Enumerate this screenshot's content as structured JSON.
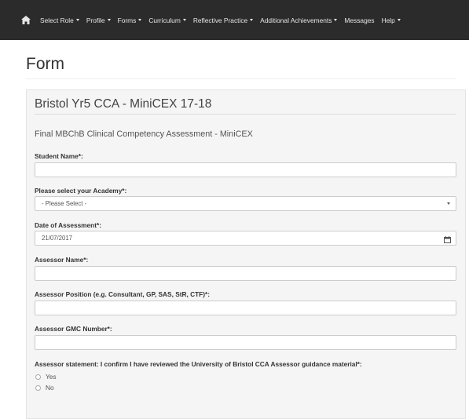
{
  "nav": {
    "items": [
      {
        "label": "Select Role",
        "dropdown": true
      },
      {
        "label": "Profile",
        "dropdown": true
      },
      {
        "label": "Forms",
        "dropdown": true
      },
      {
        "label": "Curriculum",
        "dropdown": true
      },
      {
        "label": "Reflective Practice",
        "dropdown": true
      },
      {
        "label": "Additional Achievements",
        "dropdown": true
      },
      {
        "label": "Messages",
        "dropdown": false
      },
      {
        "label": "Help",
        "dropdown": true
      }
    ]
  },
  "page": {
    "title": "Form"
  },
  "form": {
    "title": "Bristol Yr5 CCA - MiniCEX 17-18",
    "subtitle": "Final MBChB Clinical Competency Assessment - MiniCEX",
    "fields": {
      "student_name": {
        "label": "Student Name*:",
        "value": ""
      },
      "academy": {
        "label": "Please select your Academy*:",
        "value": "- Please Select -"
      },
      "date": {
        "label": "Date of Assessment*:",
        "value": "21/07/2017"
      },
      "assessor_name": {
        "label": "Assessor Name*:",
        "value": ""
      },
      "assessor_position": {
        "label": "Assessor Position (e.g. Consultant, GP, SAS, StR, CTF)*:",
        "value": ""
      },
      "assessor_gmc": {
        "label": "Assessor GMC Number*:",
        "value": ""
      },
      "assessor_statement": {
        "label": "Assessor statement: I confirm I have reviewed the University of Bristol CCA Assessor guidance material*:",
        "options": [
          "Yes",
          "No"
        ]
      }
    }
  },
  "colors": {
    "navbar": "#2b2b2b",
    "panel": "#f5f5f5"
  },
  "icons": {
    "home": "home-icon",
    "calendar": "calendar-icon"
  }
}
